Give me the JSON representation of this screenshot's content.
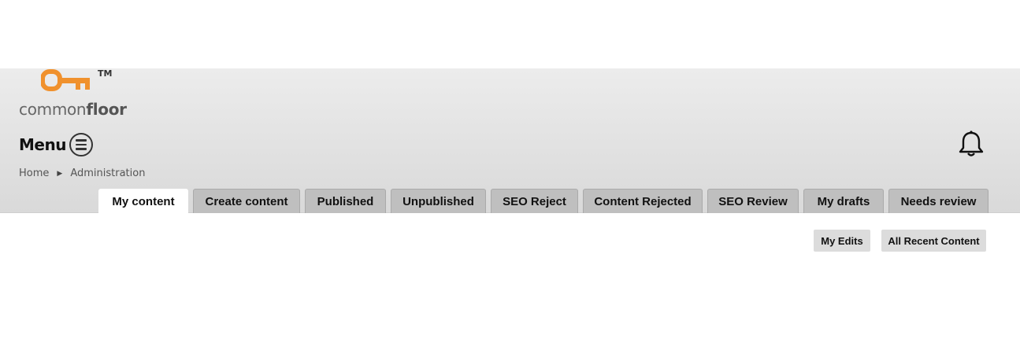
{
  "brand": {
    "logo_text_light": "common",
    "logo_text_bold": "floor",
    "trademark": "TM",
    "accent_color": "#f0912d"
  },
  "menu": {
    "label": "Menu",
    "icon": "hamburger-circle-icon"
  },
  "notifications": {
    "icon": "bell-icon"
  },
  "breadcrumb": {
    "items": [
      "Home",
      "Administration"
    ],
    "separator": "▶"
  },
  "tabs": [
    {
      "label": "My content",
      "active": true
    },
    {
      "label": "Create content",
      "active": false
    },
    {
      "label": "Published",
      "active": false
    },
    {
      "label": "Unpublished",
      "active": false
    },
    {
      "label": "SEO Reject",
      "active": false
    },
    {
      "label": "Content Rejected",
      "active": false
    },
    {
      "label": "SEO Review",
      "active": false
    },
    {
      "label": "My drafts",
      "active": false
    },
    {
      "label": "Needs review",
      "active": false
    }
  ],
  "actions": {
    "my_edits": "My Edits",
    "all_recent_content": "All Recent Content"
  }
}
